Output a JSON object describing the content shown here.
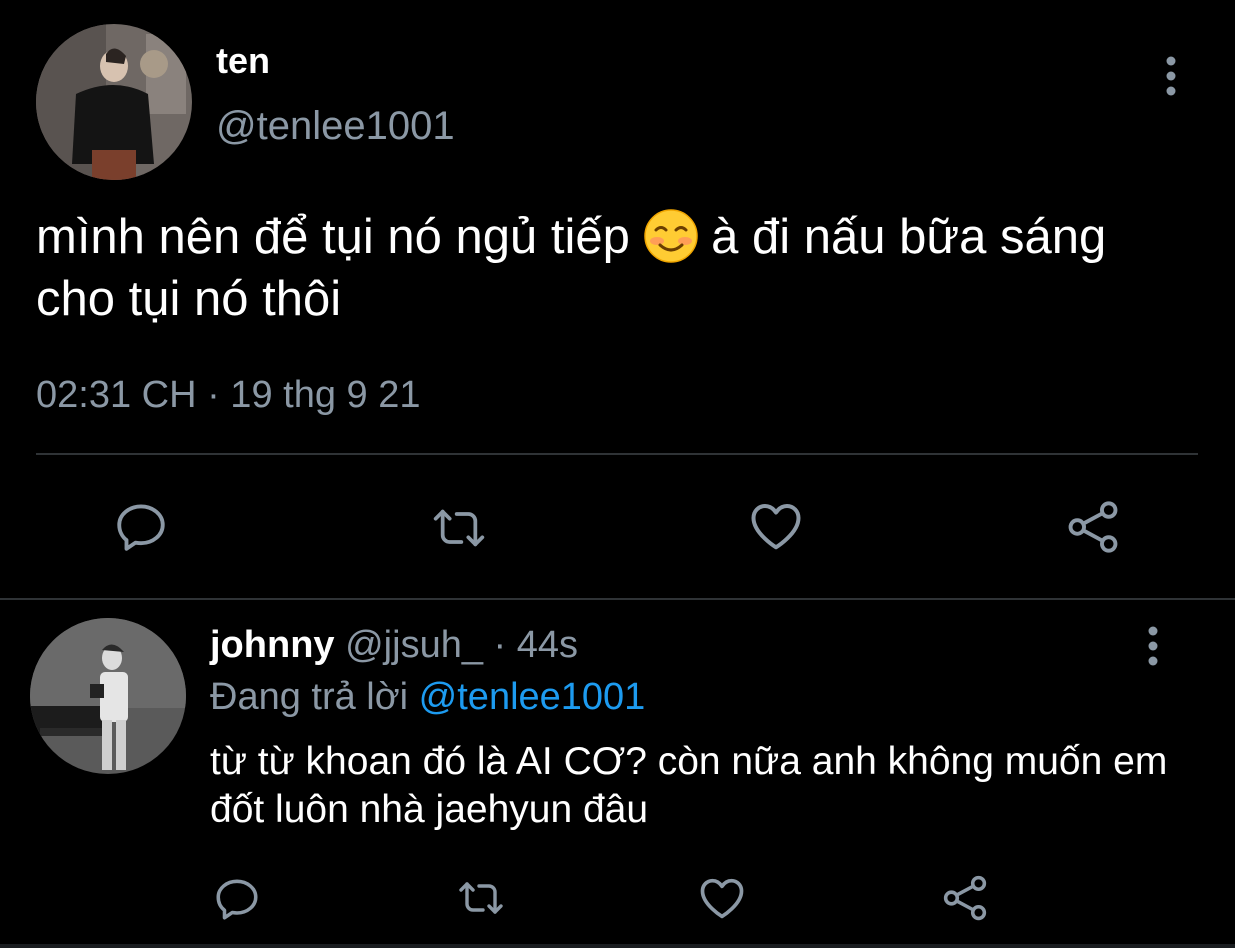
{
  "main_tweet": {
    "display_name": "ten",
    "handle": "@tenlee1001",
    "text_before_emoji": "mình nên để tụi nó ngủ tiếp ",
    "emoji": "smiling-face-with-blush",
    "text_after_emoji": " à đi nấu bữa sáng cho tụi nó thôi",
    "timestamp": "02:31 CH · 19 thg 9 21"
  },
  "reply": {
    "display_name": "johnny",
    "handle": "@jjsuh_",
    "time": " · 44s",
    "replying_prefix": "Đang trả lời ",
    "replying_to": "@tenlee1001",
    "text": "từ từ khoan đó là AI CƠ? còn nữa anh không muốn em đốt luôn nhà jaehyun đâu"
  },
  "icons": {
    "reply": "reply-icon",
    "retweet": "retweet-icon",
    "like": "heart-icon",
    "share": "share-icon",
    "more": "more-vertical-icon"
  },
  "colors": {
    "background": "#000000",
    "text": "#ffffff",
    "secondary": "#8b98a5",
    "mention": "#1d9bf0",
    "divider": "#2f3336"
  }
}
